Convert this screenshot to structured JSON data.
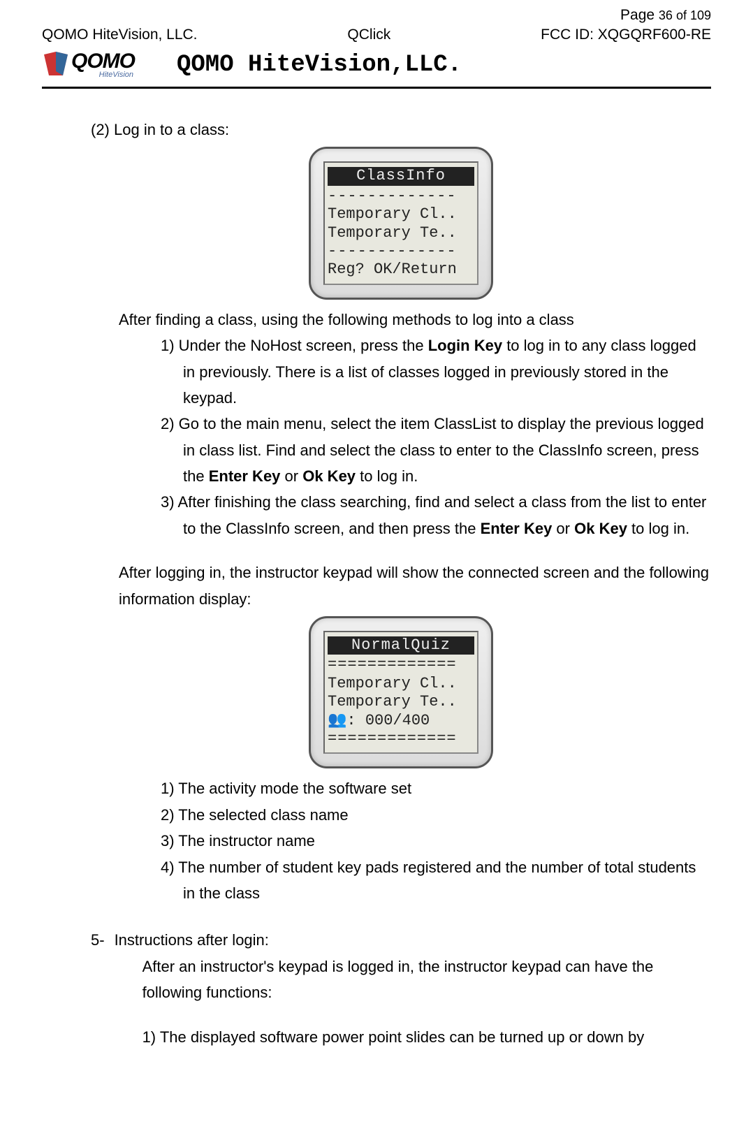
{
  "header": {
    "company_left": "QOMO HiteVision, LLC.",
    "product_center": "QClick",
    "page_label_prefix": "Page ",
    "page_current": "36",
    "page_of": " of ",
    "page_total": "109",
    "fcc_label": "FCC ID: XQGQRF600-RE",
    "logo_brand_main": "QOMO",
    "logo_brand_sub": "HiteVision",
    "company_title": "QOMO HiteVision,LLC."
  },
  "body": {
    "s2_label": "(2) Log in to a class:",
    "device1": {
      "title": "ClassInfo",
      "line1": "Temporary Cl..",
      "line2": "Temporary Te..",
      "dashes": "-------------",
      "prompt": "Reg? OK/Return"
    },
    "p_after_find": "After finding a class, using the following methods to log into a class",
    "m1_a": "1) Under the NoHost screen, press the ",
    "m1_bold": "Login Key",
    "m1_b": " to log in to any class logged in previously. There is a list of classes logged in previously stored in the keypad.",
    "m2_a": "2) Go to the main menu, select the item ClassList to display the previous logged in class list. Find and select the class to enter to the ClassInfo screen, press the ",
    "m2_bold1": "Enter Key",
    "m2_mid": " or ",
    "m2_bold2": "Ok Key",
    "m2_b": " to log in.",
    "m3_a": "3) After finishing the class searching, find and select a class from the list to enter to the ClassInfo screen, and then press the ",
    "m3_bold1": "Enter Key",
    "m3_mid": " or ",
    "m3_bold2": "Ok Key",
    "m3_b": " to log in.",
    "p_after_login": "After logging in, the instructor keypad will show the connected screen and the following information display:",
    "device2": {
      "title": "NormalQuiz",
      "line1": "Temporary Cl..",
      "line2": "Temporary Te..",
      "icon": "👥",
      "count_sep": ": ",
      "count": "000/400",
      "eqs": "============="
    },
    "info_list": {
      "i1": "1) The activity mode the software set",
      "i2": "2) The selected class name",
      "i3": "3) The instructor name",
      "i4": "4) The number of student key pads registered and the number of total students in the class"
    },
    "sec5_num": "5-",
    "sec5_title": "Instructions after login:",
    "sec5_intro": "After an instructor's keypad is logged in, the instructor keypad can have the following functions:",
    "sec5_f1": "1) The displayed software power point slides can be turned up or down by"
  }
}
